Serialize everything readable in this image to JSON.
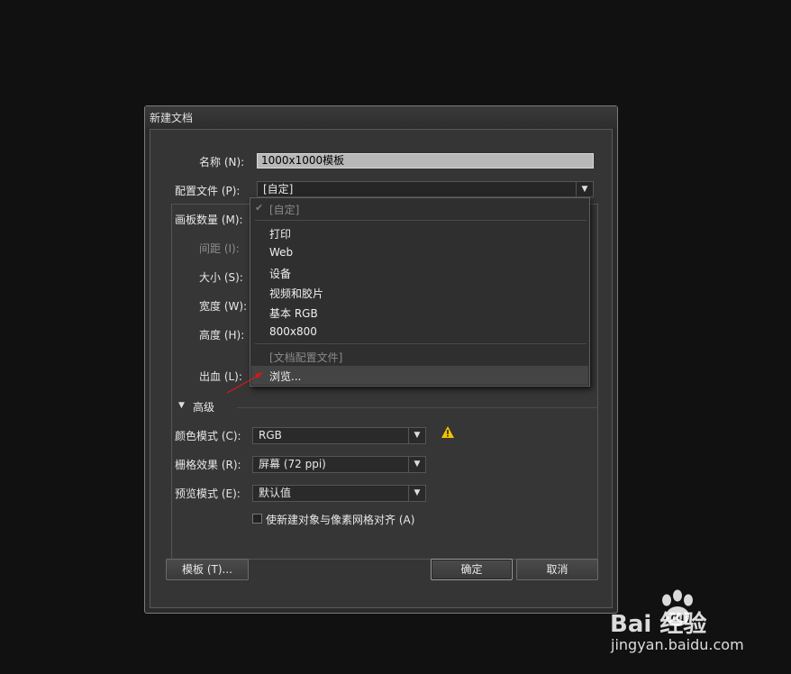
{
  "dialog": {
    "title": "新建文档",
    "name_label": "名称 (N):",
    "name_value": "1000x1000模板",
    "profile_label": "配置文件 (P):",
    "profile_value": "[自定]",
    "artboards_label": "画板数量 (M):",
    "spacing_label": "间距 (I):",
    "size_label": "大小 (S):",
    "width_label": "宽度 (W):",
    "height_label": "高度 (H):",
    "bleed_label": "出血 (L):",
    "advanced_label": "高级",
    "color_mode_label": "颜色模式 (C):",
    "color_mode_value": "RGB",
    "raster_label": "栅格效果 (R):",
    "raster_value": "屏幕 (72 ppi)",
    "preview_label": "预览模式 (E):",
    "preview_value": "默认值",
    "align_checkbox_label": "使新建对象与像素网格对齐 (A)",
    "template_button": "模板 (T)...",
    "ok_button": "确定",
    "cancel_button": "取消",
    "warning_color": "#f2c200"
  },
  "dropdown": {
    "items": [
      {
        "label": "[自定]"
      },
      {
        "label": "打印"
      },
      {
        "label": "Web"
      },
      {
        "label": "设备"
      },
      {
        "label": "视频和胶片"
      },
      {
        "label": "基本 RGB"
      },
      {
        "label": "800x800"
      },
      {
        "label": "[文档配置文件]"
      },
      {
        "label": "浏览..."
      }
    ]
  },
  "watermark": {
    "brand": "Bai  经验",
    "url": "jingyan.baidu.com"
  }
}
